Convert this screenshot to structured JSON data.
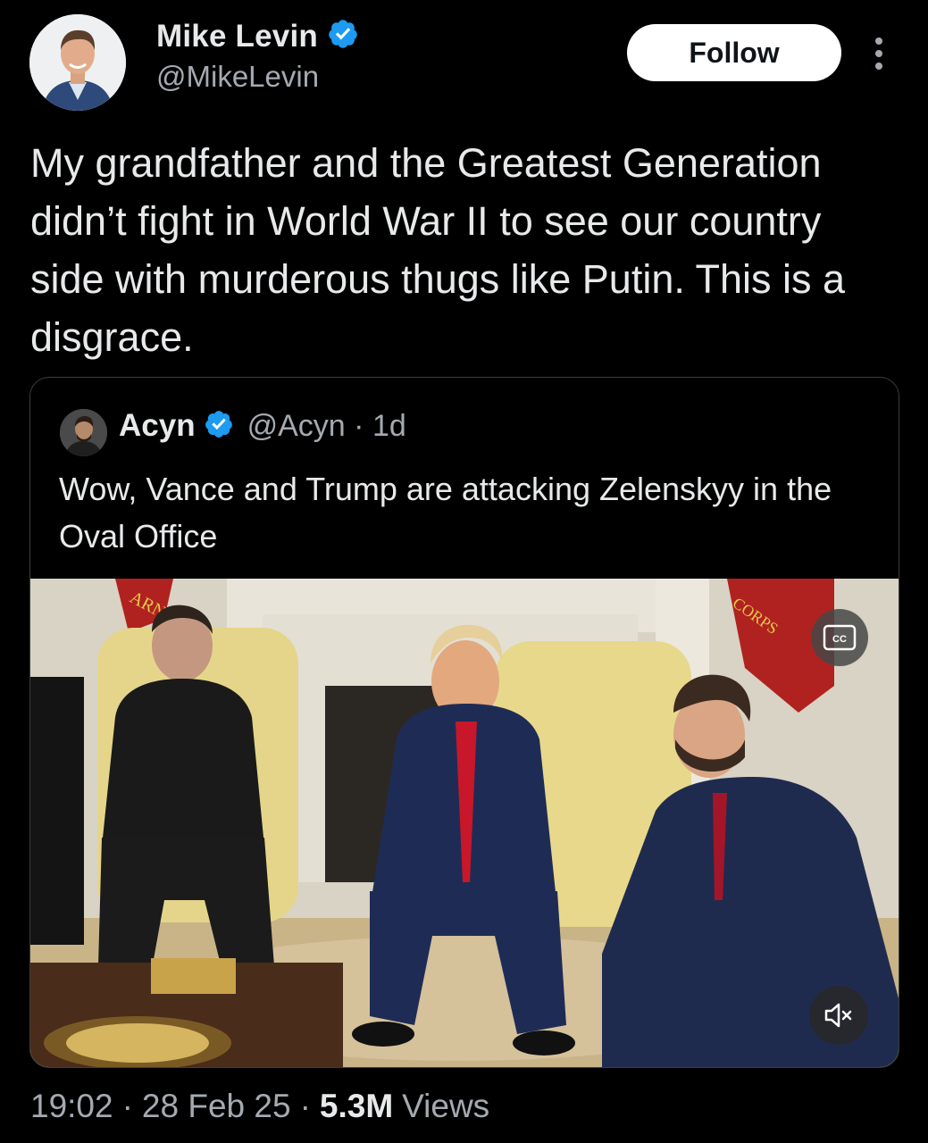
{
  "author": {
    "name": "Mike Levin",
    "handle": "@MikeLevin",
    "verified": true
  },
  "actions": {
    "follow_label": "Follow"
  },
  "tweet": {
    "text": "My grandfather and the Greatest Generation didn’t fight in World War II to see our country side with murderous thugs like Putin. This is a disgrace."
  },
  "quoted": {
    "name": "Acyn",
    "handle": "@Acyn",
    "separator": "·",
    "time": "1d",
    "text": "Wow, Vance and Trump are attacking Zelenskyy in the Oval Office",
    "media": {
      "type": "video",
      "cc_label": "CC",
      "flag_text_left": "ARN",
      "flag_text_right": "CORPS"
    }
  },
  "footer": {
    "time": "19:02",
    "sep1": "·",
    "date": "28 Feb 25",
    "sep2": "·",
    "views_count": "5.3M",
    "views_label": "Views"
  },
  "colors": {
    "background": "#000000",
    "text": "#e7e9ea",
    "secondary": "#a5aab0",
    "verified": "#1d9bf0",
    "border": "#3a3e42"
  }
}
